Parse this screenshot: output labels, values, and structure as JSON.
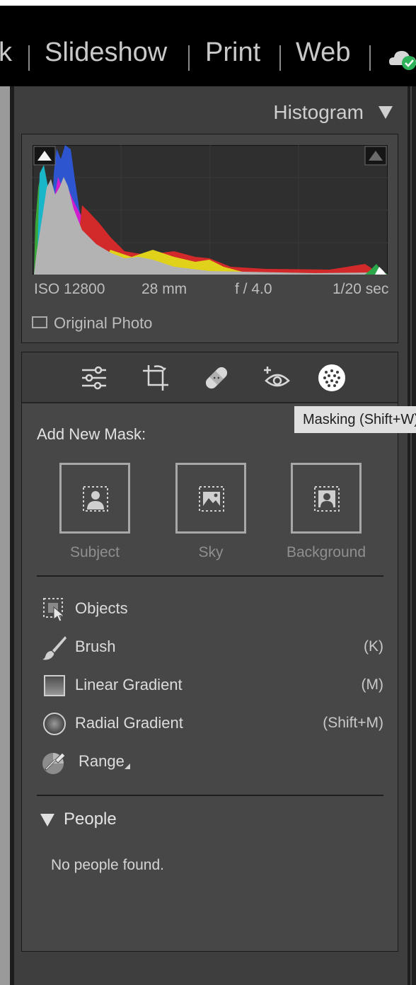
{
  "modules": {
    "items": [
      "k",
      "Slideshow",
      "Print",
      "Web"
    ]
  },
  "histogram": {
    "title": "Histogram",
    "meta": {
      "iso": "ISO 12800",
      "focal": "28 mm",
      "aperture": "f / 4.0",
      "shutter": "1/20 sec"
    },
    "original_photo_label": "Original Photo",
    "original_photo_checked": false
  },
  "tools": {
    "items": [
      "edit-sliders-icon",
      "crop-icon",
      "healing-icon",
      "red-eye-icon",
      "masking-icon"
    ],
    "active": "masking-icon",
    "tooltip": "Masking (Shift+W)"
  },
  "masking": {
    "add_new_label": "Add New Mask:",
    "quick_masks": [
      {
        "label": "Subject",
        "icon": "select-subject-icon"
      },
      {
        "label": "Sky",
        "icon": "select-sky-icon"
      },
      {
        "label": "Background",
        "icon": "select-background-icon"
      }
    ],
    "tools": [
      {
        "label": "Objects",
        "shortcut": "",
        "icon": "objects-icon"
      },
      {
        "label": "Brush",
        "shortcut": "(K)",
        "icon": "brush-icon"
      },
      {
        "label": "Linear Gradient",
        "shortcut": "(M)",
        "icon": "linear-gradient-icon"
      },
      {
        "label": "Radial Gradient",
        "shortcut": "(Shift+M)",
        "icon": "radial-gradient-icon"
      },
      {
        "label": "Range",
        "shortcut": "",
        "icon": "range-icon"
      }
    ]
  },
  "people": {
    "title": "People",
    "empty_text": "No people found."
  },
  "colors": {
    "panel_bg": "#474747",
    "tooltip_bg": "#e0e0e0",
    "sync_badge": "#2fb35a"
  }
}
